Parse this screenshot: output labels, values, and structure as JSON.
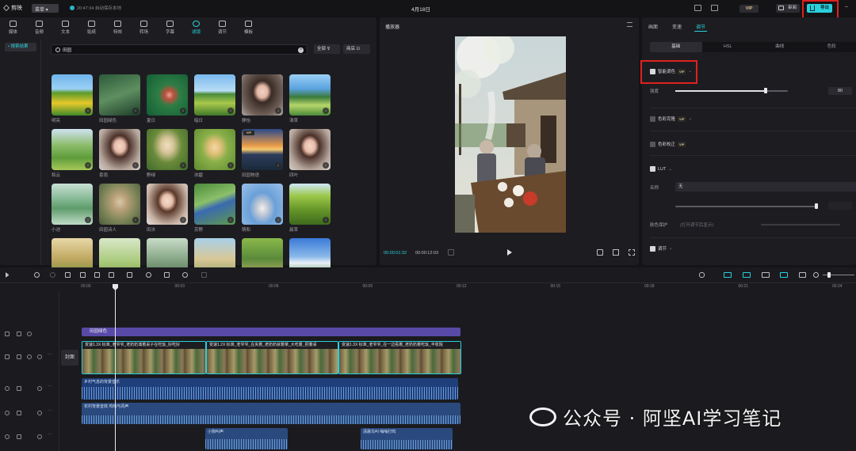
{
  "topbar": {
    "app_name": "剪映",
    "menu_label": "菜单 ▾",
    "save_status": "20:47:34 自动保存本地",
    "project_title": "4月18日",
    "vip_label": "VIP",
    "review_label": "审阅",
    "export_label": "导出",
    "highlight_color": "#e02020",
    "accent_color": "#2ad0dc"
  },
  "media_tabs": [
    {
      "label": "媒体",
      "icon": "media-icon"
    },
    {
      "label": "音频",
      "icon": "audio-icon"
    },
    {
      "label": "文本",
      "icon": "text-icon"
    },
    {
      "label": "贴纸",
      "icon": "sticker-icon"
    },
    {
      "label": "特效",
      "icon": "effects-icon"
    },
    {
      "label": "转场",
      "icon": "transition-icon"
    },
    {
      "label": "字幕",
      "icon": "subtitle-icon"
    },
    {
      "label": "滤镜",
      "icon": "filter-icon",
      "active": true
    },
    {
      "label": "调节",
      "icon": "adjust-icon"
    },
    {
      "label": "模板",
      "icon": "template-icon"
    }
  ],
  "media_sidebar": {
    "active_item": "• 搜索结果"
  },
  "search": {
    "value": "田园",
    "filter_all": "全部 ⊽",
    "store": "商店 ⊡"
  },
  "filters": [
    {
      "label": "明亮",
      "thumb": "t-field"
    },
    {
      "label": "田园绿色",
      "thumb": "t-forest"
    },
    {
      "label": "夏日",
      "thumb": "t-hand"
    },
    {
      "label": "暗日",
      "thumb": "t-track"
    },
    {
      "label": "静怡",
      "thumb": "t-girl"
    },
    {
      "label": "清草",
      "thumb": "t-lake"
    },
    {
      "label": "和云",
      "thumb": "t-meadow"
    },
    {
      "label": "喜雨",
      "thumb": "t-girl2"
    },
    {
      "label": "野绿",
      "thumb": "t-hat"
    },
    {
      "label": "浓碧",
      "thumb": "t-yellow"
    },
    {
      "label": "田园物语",
      "thumb": "t-sunset",
      "vip": true
    },
    {
      "label": "四叶",
      "thumb": "t-girl2"
    },
    {
      "label": "小池",
      "thumb": "t-pond"
    },
    {
      "label": "田园诗人",
      "thumb": "t-statue"
    },
    {
      "label": "田沐",
      "thumb": "t-girl3"
    },
    {
      "label": "苏野",
      "thumb": "t-lying"
    },
    {
      "label": "萌和",
      "thumb": "t-flower"
    },
    {
      "label": "晨草",
      "thumb": "t-tree"
    },
    {
      "label": "",
      "thumb": "t-r5a"
    },
    {
      "label": "",
      "thumb": "t-r5b"
    },
    {
      "label": "",
      "thumb": "t-r5c"
    },
    {
      "label": "",
      "thumb": "t-r5d"
    },
    {
      "label": "",
      "thumb": "t-r5e"
    },
    {
      "label": "",
      "thumb": "t-r5f"
    }
  ],
  "player": {
    "title": "播放器",
    "current_time": "00:00:01:32",
    "total_time": "00:00:12:03"
  },
  "adjust": {
    "tabs": [
      "画面",
      "变速",
      "调节"
    ],
    "active_tab": "调节",
    "subtabs": [
      "基础",
      "HSL",
      "曲线",
      "色轮"
    ],
    "active_subtab": "基础",
    "smart_color_label": "智能调色",
    "strength_label": "强度",
    "strength_value": "80",
    "strength_fraction": 0.8,
    "color_match_label": "色彩克隆",
    "color_correct_label": "色彩校正",
    "lut_label": "LUT",
    "name_label": "名称",
    "name_value": "无",
    "skin_label": "肤色保护",
    "skin_hint": "(打开调节后显示)",
    "adjust_label": "调节",
    "vip_label": "VIP"
  },
  "timeline": {
    "ruler": [
      "00:00",
      "00:03",
      "00:06",
      "00:09",
      "00:12",
      "00:15",
      "00:18",
      "00:21",
      "00:24"
    ],
    "cover_label": "封面",
    "filter_clip": "田园绿色",
    "video_clips": [
      "变速1.3X  标准_老爷爷_老奶奶凑着桌子在吃饭_好吃好",
      "变速1.2X  标准_老爷爷_在夹着_老奶奶就着菜_大吃着_把着桌",
      "变速1.3X  标准_老爷爷_在一边看着_老奶奶着吃饭_丰收院"
    ],
    "audio_clips": [
      "乡村气息的背景音乐",
      "农村背景音效 鸡鸣与风声",
      "小狗叫声",
      "清晨鸟叫 嗡嗡打鸣"
    ]
  },
  "watermark": {
    "text": "公众号 · 阿坚AI学习笔记",
    "icon": "wechat-icon"
  }
}
